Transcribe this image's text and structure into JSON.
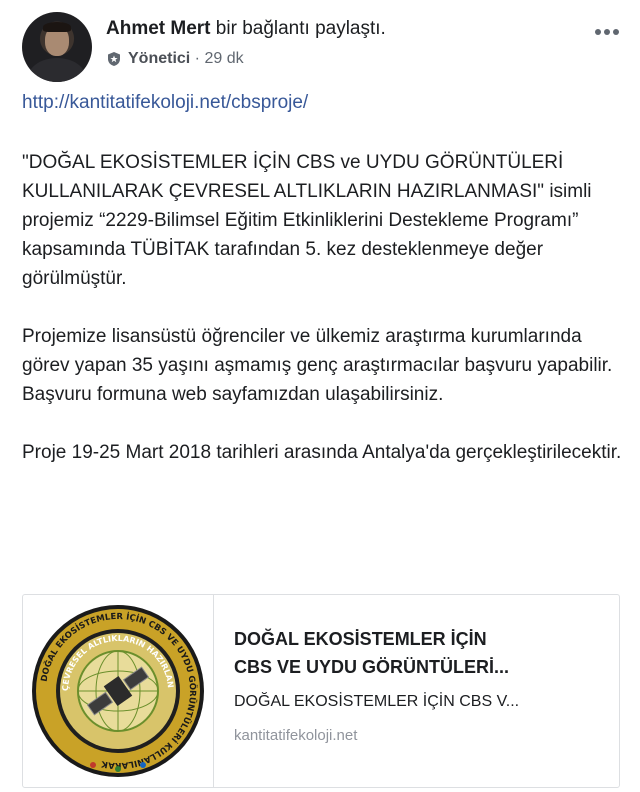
{
  "post": {
    "author_name": "Ahmet Mert",
    "action": " bir bağlantı paylaştı.",
    "role": "Yönetici",
    "separator": " · ",
    "time": "29 dk",
    "link_url": "http://kantitatifekoloji.net/cbsproje/",
    "paragraphs": [
      "\"DOĞAL EKOSİSTEMLER İÇİN CBS ve UYDU GÖRÜNTÜLERİ KULLANILARAK ÇEVRESEL ALTLIKLARIN HAZIRLANMASI\" isimli projemiz “2229-Bilimsel Eğitim Etkinliklerini Destekleme Programı” kapsamında TÜBİTAK tarafından 5. kez desteklenmeye değer görülmüştür.",
      "Projemize lisansüstü öğrenciler ve ülkemiz araştırma kurumlarında görev yapan 35 yaşını aşmamış genç araştırmacılar başvuru yapabilir. Başvuru formuna web sayfamızdan ulaşabilirsiniz.",
      "Proje 19-25 Mart 2018 tarihleri arasında Antalya'da gerçekleştirilecektir."
    ]
  },
  "icons": {
    "more": "more-options-icon",
    "role_badge": "shield-badge-icon",
    "avatar": "profile-photo"
  },
  "card": {
    "title_line1": "DOĞAL EKOSİSTEMLER İÇİN",
    "title_line2": "CBS VE UYDU GÖRÜNTÜLERİ...",
    "description": "DOĞAL EKOSİSTEMLER İÇİN CBS V...",
    "domain": "kantitatifekoloji.net",
    "logo_text_outer": "DOĞAL EKOSİSTEMLER İÇİN CBS VE UYDU GÖRÜNTÜLERİ KULLANILARAK",
    "logo_text_inner": "ÇEVRESEL ALTLIKLARIN HAZIRLANMASI"
  },
  "colors": {
    "link": "#385898",
    "secondary_text": "#606770",
    "logo_gold": "#c9a227",
    "logo_green": "#6b8f2c"
  }
}
